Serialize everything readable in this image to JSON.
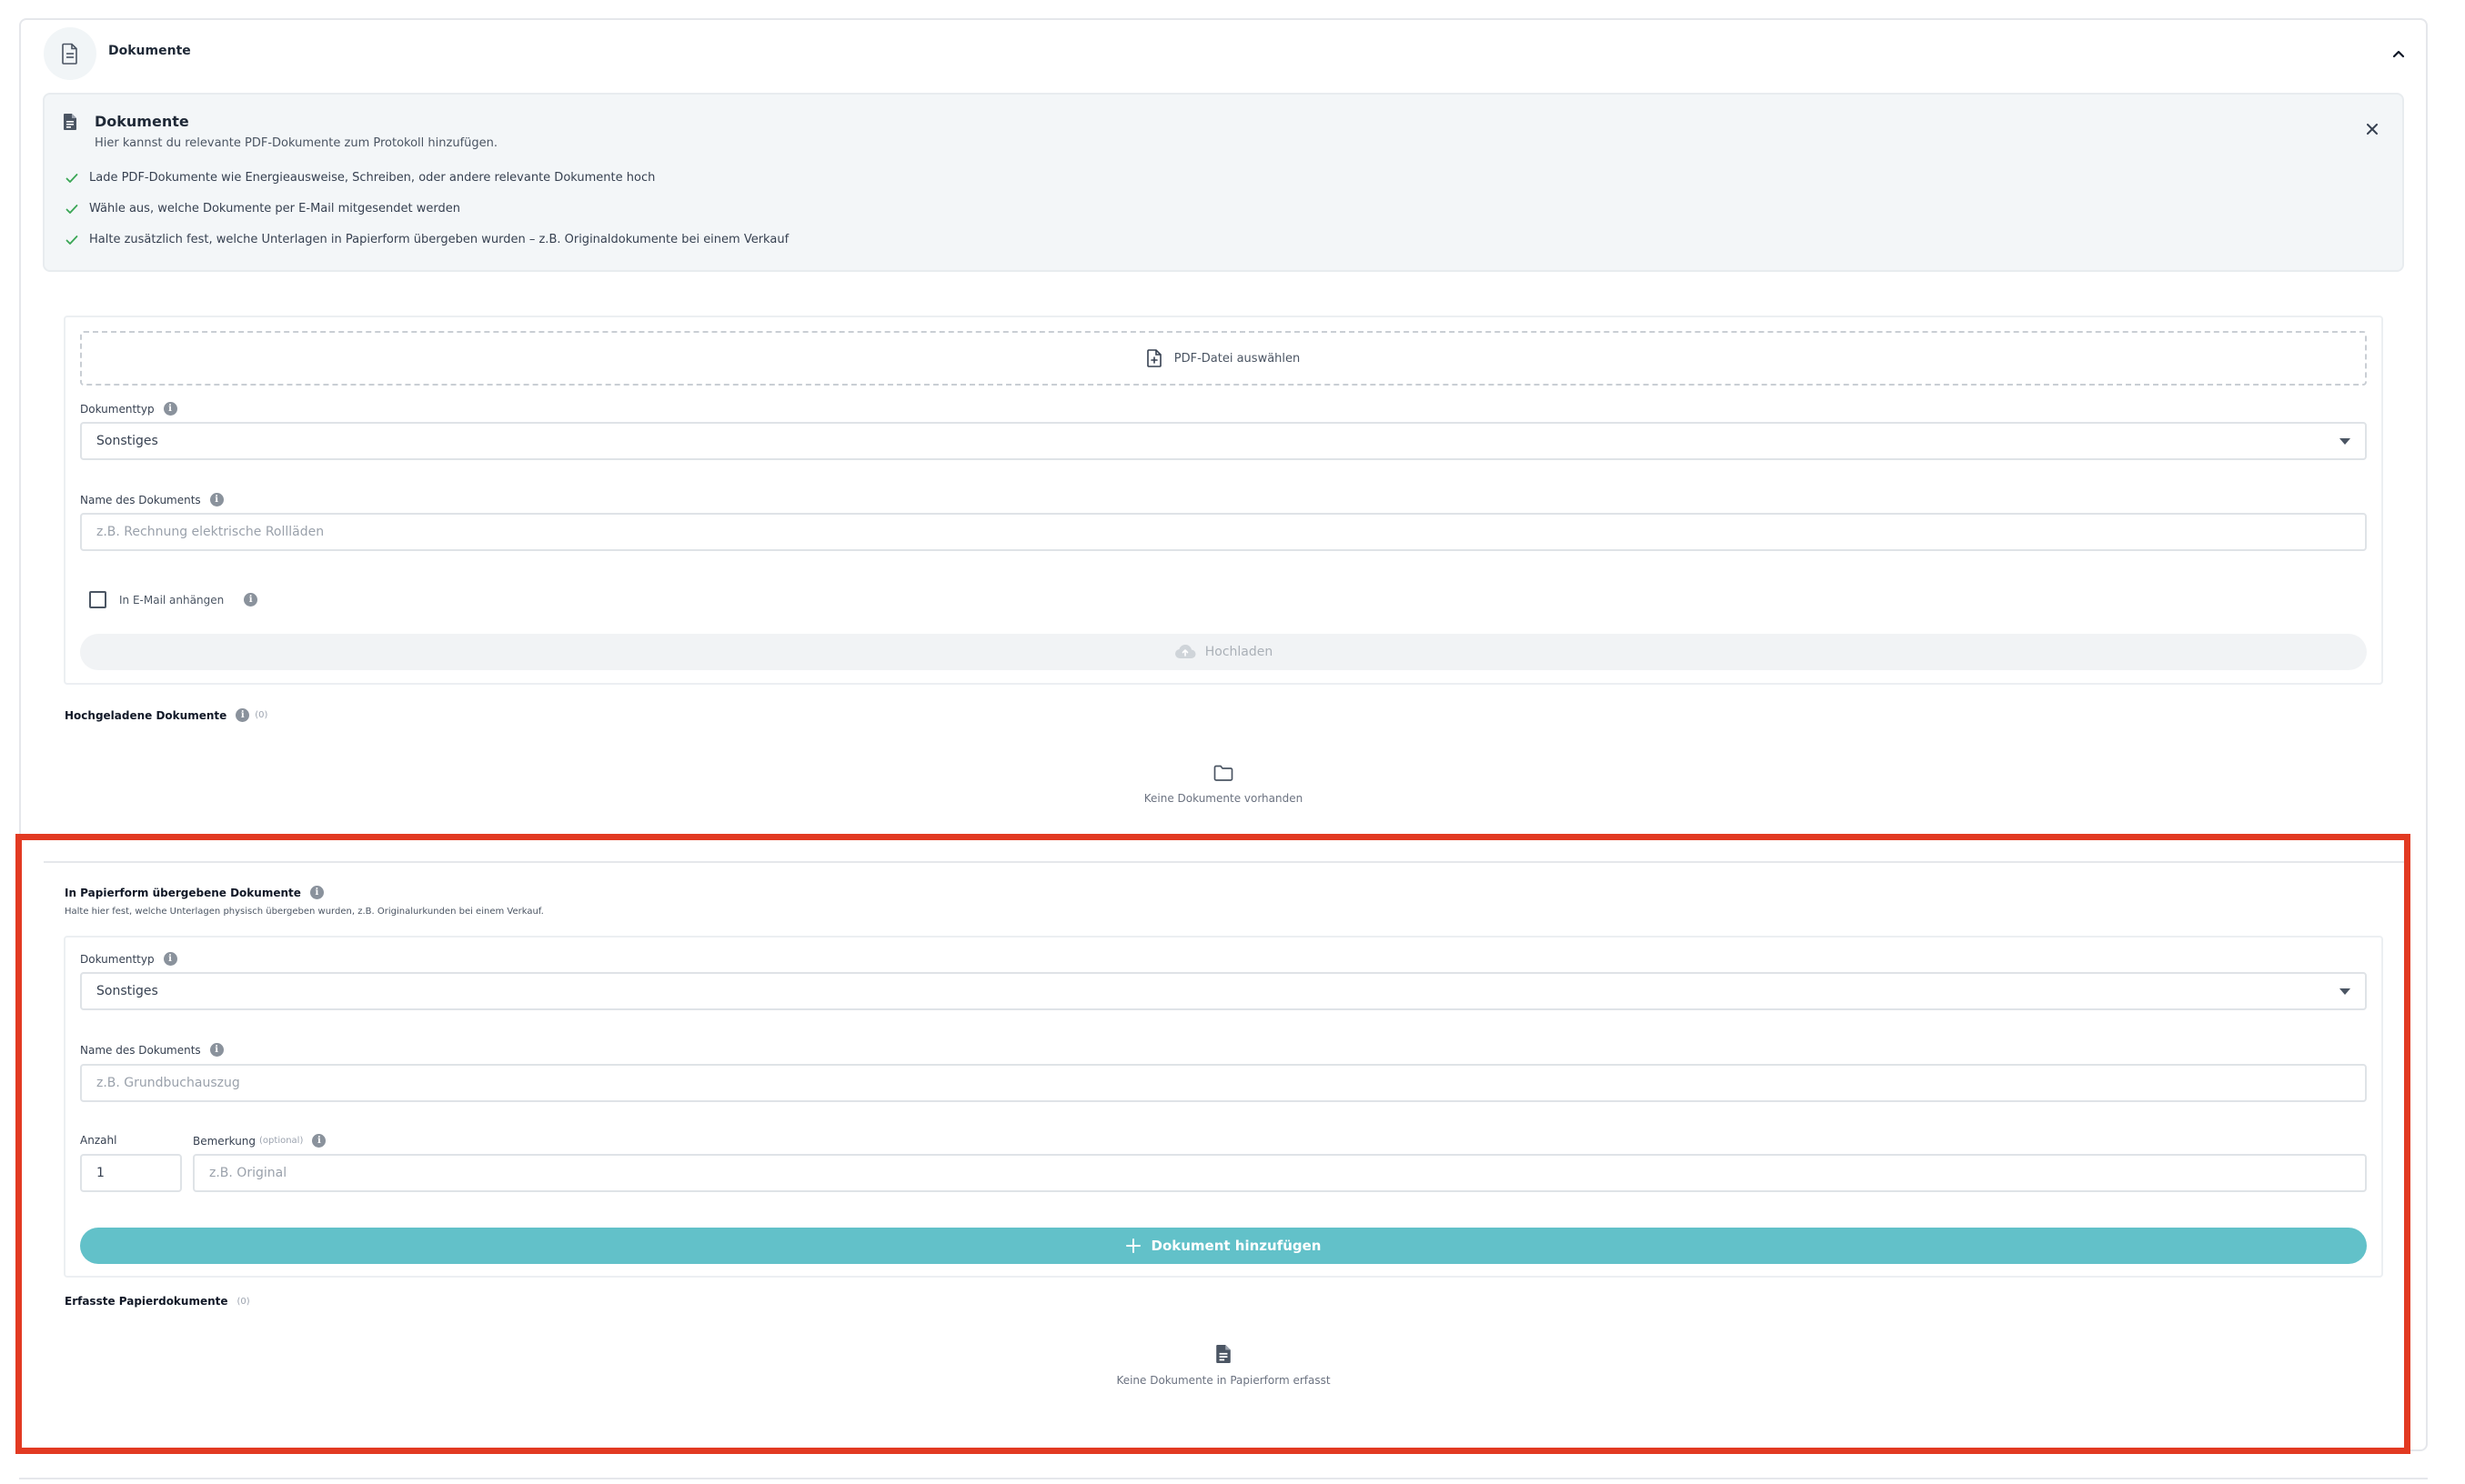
{
  "section": {
    "title": "Dokumente",
    "icon": "document-icon"
  },
  "info": {
    "title": "Dokumente",
    "subtitle": "Hier kannst du relevante PDF-Dokumente zum Protokoll hinzufügen.",
    "items": [
      "Lade PDF-Dokumente wie Energieausweise, Schreiben, oder andere relevante Dokumente hoch",
      "Wähle aus, welche Dokumente per E-Mail mitgesendet werden",
      "Halte zusätzlich fest, welche Unterlagen in Papierform übergeben wurden – z.B. Originaldokumente bei einem Verkauf"
    ],
    "check_color": "#3aa655"
  },
  "upload": {
    "dropzone_label": "PDF-Datei auswählen",
    "doctype_label": "Dokumenttyp",
    "doctype_value": "Sonstiges",
    "name_label": "Name des Dokuments",
    "name_placeholder": "z.B. Rechnung elektrische Rollläden",
    "email_checkbox_label": "In E-Mail anhängen",
    "email_checked": false,
    "upload_button": "Hochladen"
  },
  "uploaded": {
    "title": "Hochgeladene Dokumente",
    "count": "(0)",
    "empty_text": "Keine Dokumente vorhanden"
  },
  "paper": {
    "title": "In Papierform übergebene Dokumente",
    "description": "Halte hier fest, welche Unterlagen physisch übergeben wurden, z.B. Originalurkunden bei einem Verkauf.",
    "doctype_label": "Dokumenttyp",
    "doctype_value": "Sonstiges",
    "name_label": "Name des Dokuments",
    "name_placeholder": "z.B. Grundbuchauszug",
    "quantity_label": "Anzahl",
    "quantity_value": "1",
    "remark_label": "Bemerkung",
    "remark_optional": "(optional)",
    "remark_placeholder": "z.B. Original",
    "add_button": "Dokument hinzufügen",
    "button_color": "#62c1c9"
  },
  "recorded": {
    "title": "Erfasste Papierdokumente",
    "count": "(0)",
    "empty_text": "Keine Dokumente in Papierform erfasst"
  },
  "highlight_color": "#e23a22"
}
